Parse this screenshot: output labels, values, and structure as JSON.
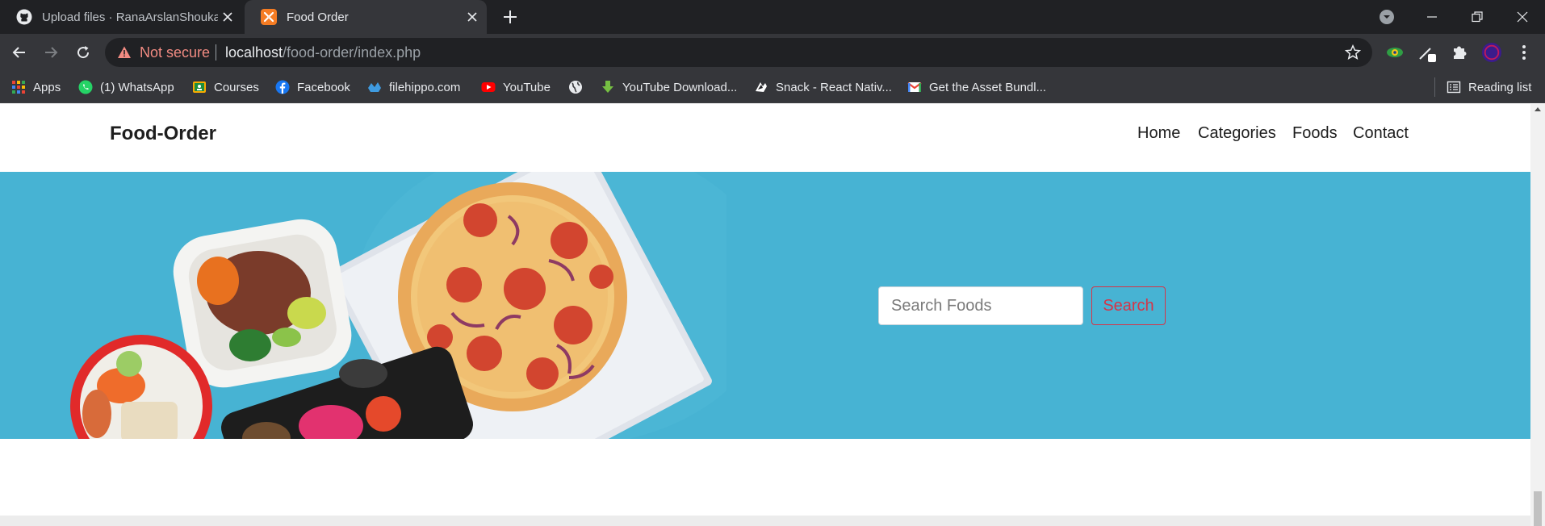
{
  "browser": {
    "tabs": [
      {
        "title": "Upload files · RanaArslanShoukat"
      },
      {
        "title": "Food Order"
      }
    ],
    "address": {
      "security_label": "Not secure",
      "host": "localhost",
      "path": "/food-order/index.php"
    },
    "bookmarks": [
      {
        "label": "Apps",
        "icon": "apps-grid-icon"
      },
      {
        "label": "(1) WhatsApp",
        "icon": "whatsapp-icon"
      },
      {
        "label": "Courses",
        "icon": "courses-icon"
      },
      {
        "label": "Facebook",
        "icon": "facebook-icon"
      },
      {
        "label": "filehippo.com",
        "icon": "filehippo-icon"
      },
      {
        "label": "YouTube",
        "icon": "youtube-icon"
      },
      {
        "label": "",
        "icon": "globe-icon"
      },
      {
        "label": "YouTube Download...",
        "icon": "download-icon"
      },
      {
        "label": "Snack - React Nativ...",
        "icon": "snack-icon"
      },
      {
        "label": "Get the Asset Bundl...",
        "icon": "gmail-icon"
      }
    ],
    "reading_list": "Reading list"
  },
  "site": {
    "logo": "Food-Order",
    "menu": [
      "Home",
      "Categories",
      "Foods",
      "Contact"
    ],
    "search": {
      "placeholder": "Search Foods",
      "button": "Search"
    }
  },
  "colors": {
    "hero_background": "#47b3d3",
    "search_button": "#d63447",
    "not_secure": "#f28b82"
  }
}
